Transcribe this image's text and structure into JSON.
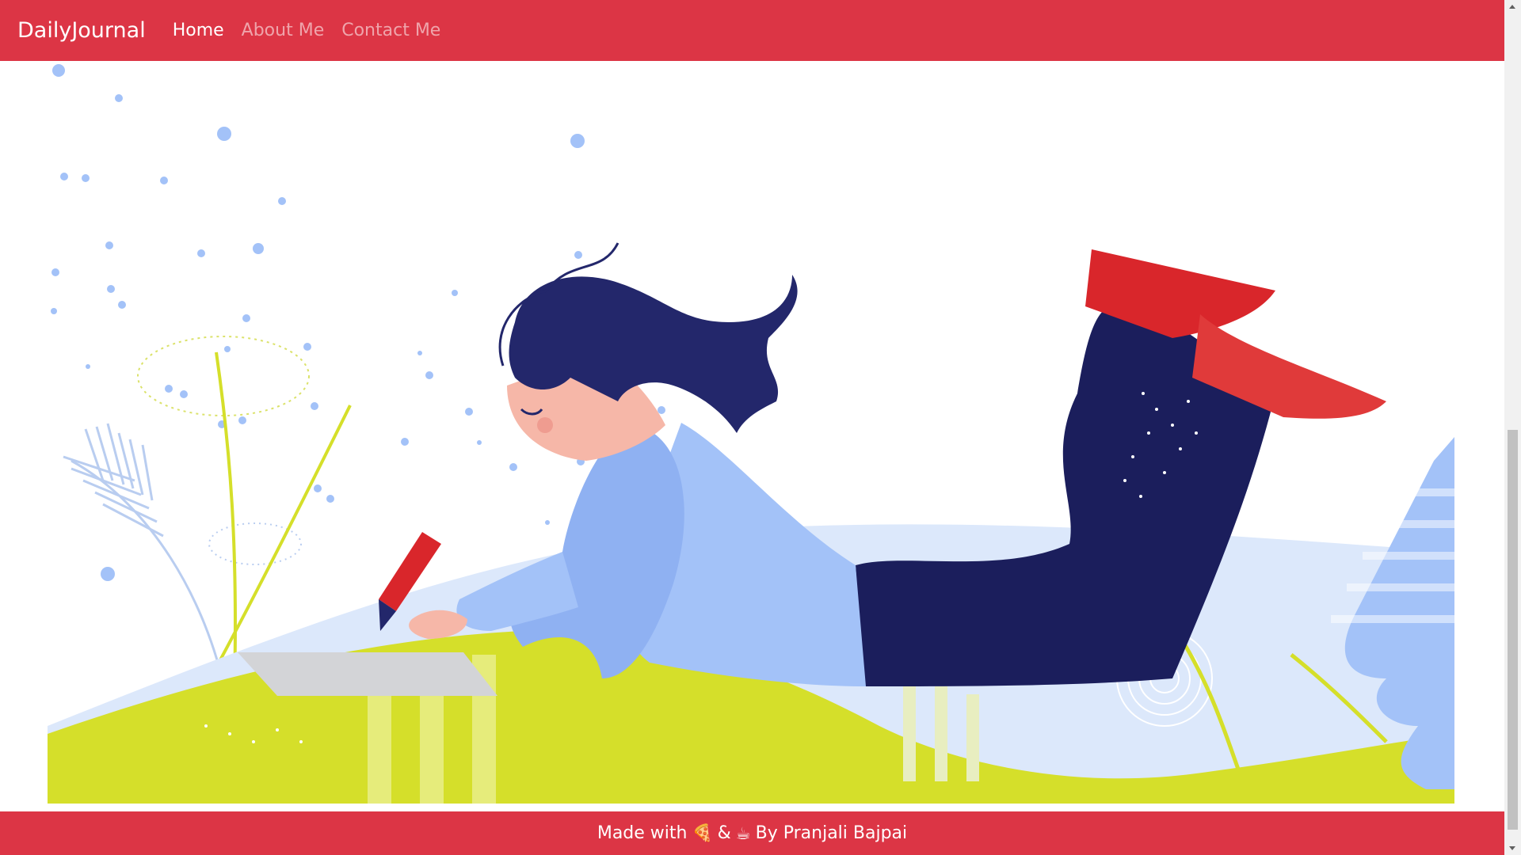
{
  "navbar": {
    "brand": "DailyJournal",
    "links": [
      {
        "label": "Home",
        "active": true
      },
      {
        "label": "About Me",
        "active": false
      },
      {
        "label": "Contact Me",
        "active": false
      }
    ]
  },
  "hero": {
    "illustration_icon": "woman-writing-journal-illustration"
  },
  "footer": {
    "prefix": "Made with",
    "pizza_emoji": "🍕",
    "ampersand": "&",
    "coffee_emoji": "☕",
    "suffix": "By Pranjali Bajpai"
  },
  "colors": {
    "brand_red": "#dc3545",
    "navy": "#23276b",
    "light_blue": "#a3c2f8",
    "lime": "#d5df2a",
    "shoe_red": "#d9262b",
    "skin": "#f6b7a8"
  }
}
